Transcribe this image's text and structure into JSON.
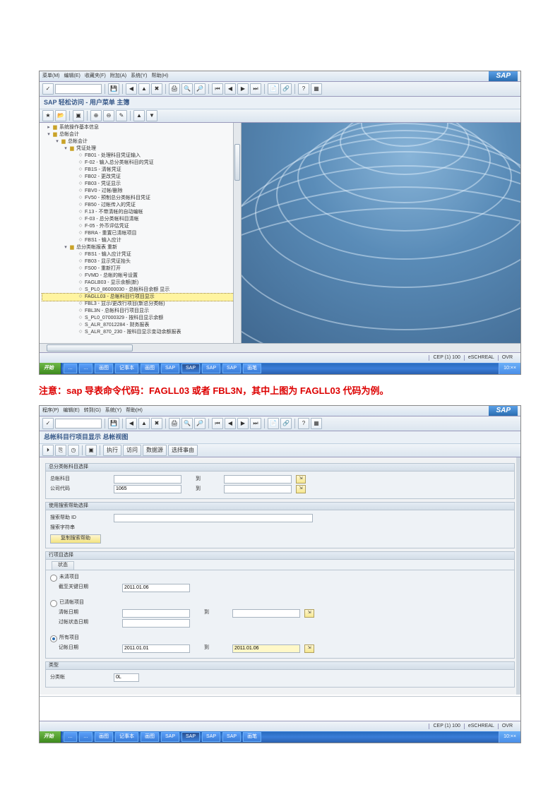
{
  "menus": [
    "菜单(M)",
    "编辑(E)",
    "收藏夹(F)",
    "附加(A)",
    "系统(Y)",
    "帮助(H)"
  ],
  "sap_logo": "SAP",
  "s1": {
    "title": "SAP 轻松访问  - 用户菜单 主簿",
    "tree": [
      {
        "d": 0,
        "t": "folder",
        "exp": "▸",
        "label": "系统操作基本信息"
      },
      {
        "d": 0,
        "t": "folder",
        "exp": "▾",
        "label": "总帐会计"
      },
      {
        "d": 1,
        "t": "folder",
        "exp": "▾",
        "label": "总帐会计"
      },
      {
        "d": 2,
        "t": "folder",
        "exp": "▾",
        "label": "凭证处理"
      },
      {
        "d": 3,
        "t": "doc",
        "label": "FB01 - 处理科目凭证输入"
      },
      {
        "d": 3,
        "t": "doc",
        "label": "F-02 - 输入总分类帐科目的凭证"
      },
      {
        "d": 3,
        "t": "doc",
        "label": "FB1S - 清帐凭证"
      },
      {
        "d": 3,
        "t": "doc",
        "label": "FB02 - 更改凭证"
      },
      {
        "d": 3,
        "t": "doc",
        "label": "FB03 - 凭证显示"
      },
      {
        "d": 3,
        "t": "doc",
        "label": "FBV0 - 过帐/删除"
      },
      {
        "d": 3,
        "t": "doc",
        "label": "FV50 - 预制总分类帐科目凭证"
      },
      {
        "d": 3,
        "t": "doc",
        "label": "FB50 - 过帐传入的凭证"
      },
      {
        "d": 3,
        "t": "doc",
        "label": "F.13 - 不带清帐的自动编帐"
      },
      {
        "d": 3,
        "t": "doc",
        "label": "F-03 - 总分类帐科目清帐"
      },
      {
        "d": 3,
        "t": "doc",
        "label": "F-05 - 外币评估凭证"
      },
      {
        "d": 3,
        "t": "doc",
        "label": "FBRA - 重置已清帐项目"
      },
      {
        "d": 3,
        "t": "doc",
        "label": "FBS1 - 输入应计"
      },
      {
        "d": 2,
        "t": "folder",
        "exp": "▾",
        "label": "总分类帐报表  重新"
      },
      {
        "d": 3,
        "t": "doc",
        "label": "FBS1 - 输入应计凭证"
      },
      {
        "d": 3,
        "t": "doc",
        "label": "FB03 - 显示凭证抬头"
      },
      {
        "d": 3,
        "t": "doc",
        "label": "FS00 - 重新打开"
      },
      {
        "d": 3,
        "t": "doc",
        "label": "FVMD - 总帐的帐号设置"
      },
      {
        "d": 3,
        "t": "doc",
        "label": "FAGLB03 - 显示余额(新)"
      },
      {
        "d": 3,
        "t": "doc",
        "label": "S_PL0_86000030 - 总帐科目余额 显示"
      },
      {
        "d": 3,
        "t": "doc",
        "hl": true,
        "label": "FAGLL03 - 总帐科目行项目显示"
      },
      {
        "d": 3,
        "t": "doc",
        "label": "FBL3 - 显示/更改行项目(新总分类帐)"
      },
      {
        "d": 3,
        "t": "doc",
        "label": "FBL3N - 总帐科目行项目显示"
      },
      {
        "d": 3,
        "t": "doc",
        "label": "S_PL0_07000329 - 按科目显示余额"
      },
      {
        "d": 3,
        "t": "doc",
        "label": "S_ALR_87012284 - 财务报表"
      },
      {
        "d": 3,
        "t": "doc",
        "label": "S_ALR_870_230 - 按科目显示变动余额报表"
      }
    ],
    "status": [
      "CEP (1) 100",
      "eSCHREAL",
      "OVR"
    ]
  },
  "anno": {
    "p1": "注意：",
    "p2": "sap 导表命令代码：",
    "c1": "FAGLL03",
    "p3": " 或者 ",
    "c2": "FBL3N",
    "p4": "，其中上图为 ",
    "c3": "FAGLL03",
    "p5": " 代码为例。"
  },
  "menus2": [
    "程序(P)",
    "编辑(E)",
    "转到(G)",
    "系统(Y)",
    "帮助(H)"
  ],
  "s2": {
    "title": "总帐科目行项目显示 总帐视图",
    "sub_toolbar_btns": [
      "执行",
      "访问",
      "数据源",
      "选择事由"
    ],
    "panel1": {
      "head": "总分类帐科目选择",
      "r1_label": "总帐科目",
      "r1_to": "到",
      "r2_label": "公司代码",
      "r2_val": "1065",
      "r2_to": "到"
    },
    "panel2": {
      "head": "使用搜索帮助选择",
      "r1_label": "搜索帮助 ID",
      "r2_label": "搜索字符串",
      "exec": "复制搜索帮助"
    },
    "panel3": {
      "head": "行项目选择",
      "sub": "状态",
      "opt1": "未清项目",
      "d1_label": "截至关键日期",
      "d1_val": "2011.01.06",
      "opt2": "已清帐项目",
      "d2_label": "清帐日期",
      "d2_to": "到",
      "d3_label": "过帐状态日期",
      "opt3": "所有项目",
      "d4_label": "记帐日期",
      "d4_val": "2011.01.01",
      "d4_to": "到",
      "d4_val2": "2011.01.06"
    },
    "panel4": {
      "head": "类型",
      "r1_label": "分类帐",
      "r1_val": "0L"
    },
    "status": [
      "CEP (1) 100",
      "eSCHREAL",
      "OVR"
    ]
  },
  "taskbar": {
    "start": "开始",
    "tasks": [
      "…",
      "…",
      "画图",
      "记事本",
      "画图",
      "SAP",
      "SAP",
      "SAP",
      "SAP",
      "画笔"
    ],
    "tray": "10:××"
  }
}
